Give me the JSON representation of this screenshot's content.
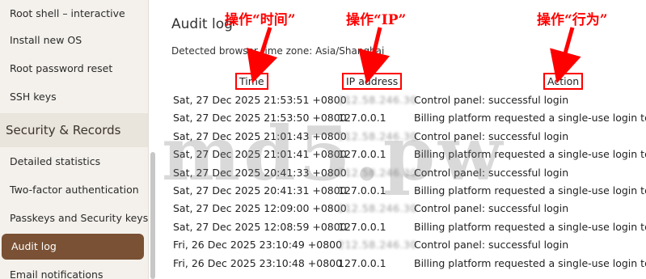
{
  "sidebar": {
    "items_top": [
      {
        "label": "Root shell – interactive"
      },
      {
        "label": "Install new OS"
      },
      {
        "label": "Root password reset"
      },
      {
        "label": "SSH keys"
      }
    ],
    "section_title": "Security & Records",
    "items_bottom": [
      {
        "label": "Detailed statistics"
      },
      {
        "label": "Two-factor authentication"
      },
      {
        "label": "Passkeys and Security keys"
      },
      {
        "label": "Audit log"
      },
      {
        "label": "Email notifications"
      }
    ],
    "active_item": "Audit log"
  },
  "main": {
    "title": "Audit log",
    "timezone_text": "Detected browser time zone: Asia/Shanghai",
    "columns": {
      "time": "Time",
      "ip": "IP address",
      "action": "Action"
    },
    "rows": [
      {
        "time": "Sat, 27 Dec 2025 21:53:51 +0800",
        "ip": "212.58.246.30",
        "ip_blurred": true,
        "action": "Control panel: successful login"
      },
      {
        "time": "Sat, 27 Dec 2025 21:53:50 +0800",
        "ip": "127.0.0.1",
        "ip_blurred": false,
        "action": "Billing platform requested a single-use login token"
      },
      {
        "time": "Sat, 27 Dec 2025 21:01:43 +0800",
        "ip": "212.58.246.30",
        "ip_blurred": true,
        "action": "Control panel: successful login"
      },
      {
        "time": "Sat, 27 Dec 2025 21:01:41 +0800",
        "ip": "127.0.0.1",
        "ip_blurred": false,
        "action": "Billing platform requested a single-use login token"
      },
      {
        "time": "Sat, 27 Dec 2025 20:41:33 +0800",
        "ip": "212.58.246.30",
        "ip_blurred": true,
        "action": "Control panel: successful login"
      },
      {
        "time": "Sat, 27 Dec 2025 20:41:31 +0800",
        "ip": "127.0.0.1",
        "ip_blurred": false,
        "action": "Billing platform requested a single-use login token"
      },
      {
        "time": "Sat, 27 Dec 2025 12:09:00 +0800",
        "ip": "212.58.246.30",
        "ip_blurred": true,
        "action": "Control panel: successful login"
      },
      {
        "time": "Sat, 27 Dec 2025 12:08:59 +0800",
        "ip": "127.0.0.1",
        "ip_blurred": false,
        "action": "Billing platform requested a single-use login token"
      },
      {
        "time": "Fri, 26 Dec 2025 23:10:49 +0800",
        "ip": "212.58.246.30",
        "ip_blurred": true,
        "action": "Control panel: successful login"
      },
      {
        "time": "Fri, 26 Dec 2025 23:10:48 +0800",
        "ip": "127.0.0.1",
        "ip_blurred": false,
        "action": "Billing platform requested a single-use login token"
      }
    ]
  },
  "annotations": {
    "time_label": "操作“时间”",
    "ip_label": "操作“IP”",
    "action_label": "操作“行为”",
    "color": "#ff0000"
  },
  "watermark": "md5.pw",
  "colors": {
    "sidebar_bg": "#f4f1ec",
    "active_bg": "#7a5134",
    "section_bg": "#e9e4dc"
  }
}
